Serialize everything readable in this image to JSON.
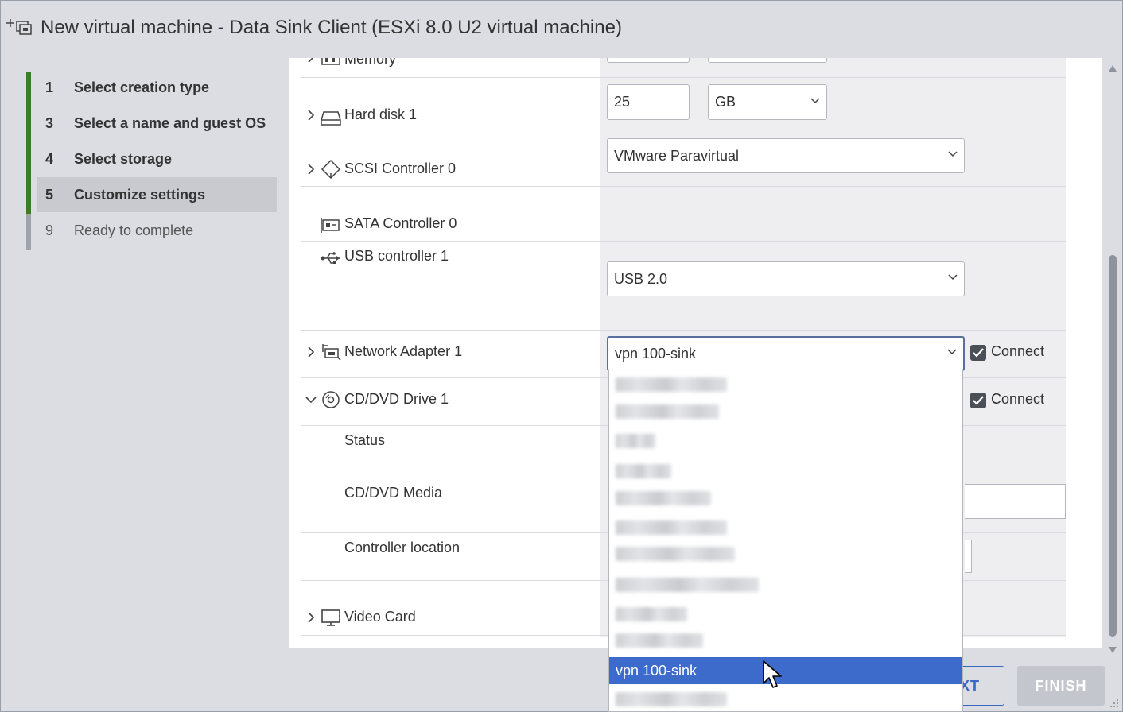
{
  "window": {
    "title": "New virtual machine - Data Sink Client (ESXi 8.0 U2 virtual machine)"
  },
  "wizard_steps": [
    {
      "number": "1",
      "label": "Select creation type",
      "state": "done"
    },
    {
      "number": "3",
      "label": "Select a name and guest OS",
      "state": "done"
    },
    {
      "number": "4",
      "label": "Select storage",
      "state": "done"
    },
    {
      "number": "5",
      "label": "Customize settings",
      "state": "active"
    },
    {
      "number": "9",
      "label": "Ready to complete",
      "state": "pending"
    }
  ],
  "hardware": {
    "memory": {
      "label": "Memory"
    },
    "hard_disk": {
      "label": "Hard disk 1",
      "size_value": "25",
      "size_unit": "GB"
    },
    "scsi": {
      "label": "SCSI Controller 0",
      "type": "VMware Paravirtual"
    },
    "sata": {
      "label": "SATA Controller 0"
    },
    "usb": {
      "label": "USB controller 1",
      "type": "USB 2.0"
    },
    "network": {
      "label": "Network Adapter 1",
      "value": "vpn 100-sink",
      "connect_label": "Connect",
      "connected": true
    },
    "cdrom": {
      "label": "CD/DVD Drive 1",
      "connect_label": "Connect",
      "connected": true,
      "status_label": "Status",
      "media_label": "CD/DVD Media",
      "controller_location_label": "Controller location"
    },
    "video": {
      "label": "Video Card"
    }
  },
  "network_dropdown": {
    "options": [
      "",
      "",
      "",
      "",
      "",
      "",
      "",
      "",
      "",
      "",
      "vpn 100-sink",
      ""
    ],
    "blurred_option_count": 11,
    "selected_label": "vpn 100-sink"
  },
  "footer": {
    "next_label": "XT",
    "finish_label": "FINISH"
  },
  "colors": {
    "accent_blue": "#3d6bcc",
    "step_done_green": "#3d7a2e",
    "chrome_gray": "#dcdde3"
  }
}
